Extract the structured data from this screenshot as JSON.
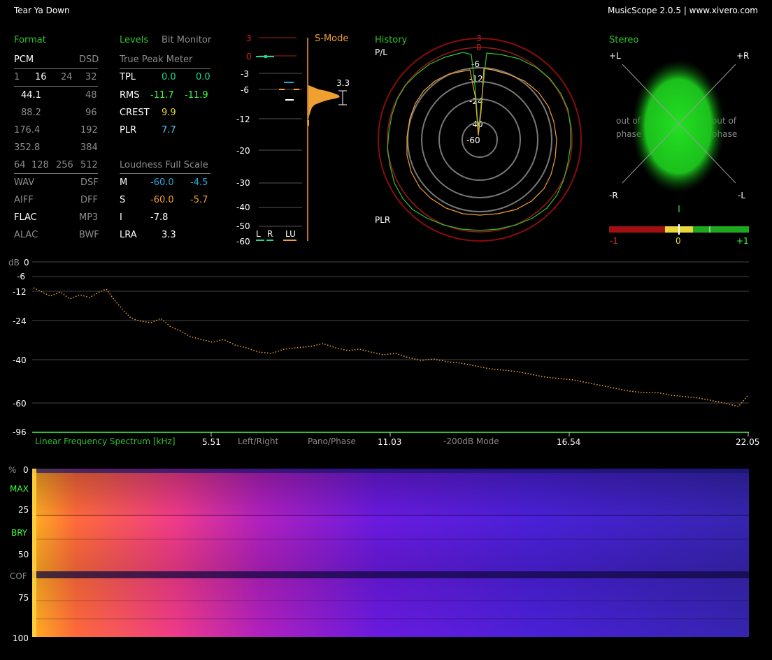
{
  "window": {
    "title": "Tear Ya Down",
    "app_info": "MusicScope 2.0.5 | www.xivero.com"
  },
  "format": {
    "header": "Format",
    "pcm": "PCM",
    "dsd": "DSD",
    "bits": [
      "1",
      "16",
      "24",
      "32"
    ],
    "rates": [
      [
        "44.1",
        "48"
      ],
      [
        "88.2",
        "96"
      ],
      [
        "176.4",
        "192"
      ],
      [
        "352.8",
        "384"
      ]
    ],
    "dsd_rates": [
      "64",
      "128",
      "256",
      "512"
    ],
    "files": [
      [
        "WAV",
        "DSF"
      ],
      [
        "AIFF",
        "DFF"
      ],
      [
        "FLAC",
        "MP3"
      ],
      [
        "ALAC",
        "BWF"
      ]
    ]
  },
  "levels": {
    "tab_levels": "Levels",
    "tab_bit_monitor": "Bit Monitor",
    "tpm_header": "True Peak Meter",
    "rows": [
      {
        "label": "TPL",
        "v1": "0.0",
        "v2": "0.0"
      },
      {
        "label": "RMS",
        "v1": "-11.7",
        "v2": "-11.9"
      },
      {
        "label": "CREST",
        "v1": "9.9"
      },
      {
        "label": "PLR",
        "v1": "7.7"
      }
    ],
    "lfs_header": "Loudness Full Scale",
    "loud": [
      {
        "label": "M",
        "v1": "-60.0",
        "v2": "-4.5"
      },
      {
        "label": "S",
        "v1": "-60.0",
        "v2": "-5.7"
      },
      {
        "label": "I",
        "v1": "-7.8"
      },
      {
        "label": "LRA",
        "v1": "3.3"
      }
    ]
  },
  "meter": {
    "ticks": [
      "3",
      "0",
      "-3",
      "-6",
      "-12",
      "-20",
      "-30",
      "-40",
      "-50",
      "-60"
    ],
    "mode": "S-Mode",
    "lra_value": "3.3",
    "channels": [
      "L",
      "R",
      "LU"
    ]
  },
  "history": {
    "header": "History",
    "pl_label": "P/L",
    "plr_label": "PLR",
    "rings": [
      "3",
      "0",
      "-6",
      "-12",
      "-24",
      "-40",
      "-60"
    ]
  },
  "stereo": {
    "header": "Stereo",
    "corners": [
      "+L",
      "+R",
      "-R",
      "-L"
    ],
    "phase_left": "out of phase",
    "phase_right": "out of phase",
    "corr_labels": [
      "-1",
      "0",
      "+1"
    ]
  },
  "spectrum": {
    "db_unit": "dB",
    "db_ticks": [
      "0",
      "-6",
      "-12",
      "-24",
      "-40",
      "-60",
      "-96"
    ],
    "mode_label": "Linear Frequency Spectrum [kHz]",
    "freq_ticks": [
      "5.51",
      "11.03",
      "16.54",
      "22.05"
    ],
    "opt_left_right": "Left/Right",
    "opt_pano_phase": "Pano/Phase",
    "opt_200db": "-200dB Mode"
  },
  "spectrogram": {
    "pct_unit": "%",
    "ticks": [
      "0",
      "25",
      "50",
      "75",
      "100"
    ],
    "markers": [
      "MAX",
      "BRY",
      "COF"
    ]
  },
  "colors": {
    "accent_green": "#2fc22f",
    "orange": "#f0a030",
    "cyan": "#2aa9d6",
    "red": "#e02020"
  }
}
